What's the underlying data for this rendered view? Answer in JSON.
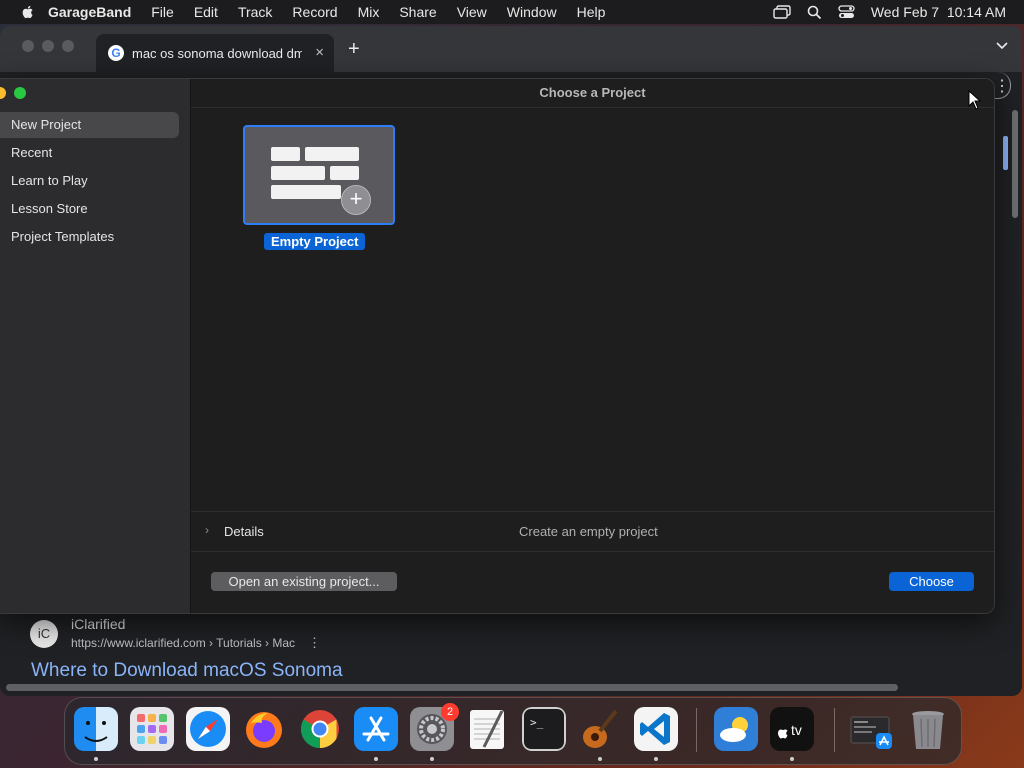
{
  "menubar": {
    "app_name": "GarageBand",
    "menus": [
      "File",
      "Edit",
      "Track",
      "Record",
      "Mix",
      "Share",
      "View",
      "Window",
      "Help"
    ],
    "datetime": "Wed Feb 7  10:14 AM"
  },
  "browser": {
    "tab_title": "mac os sonoma download dmg",
    "tab_close": "×",
    "new_tab": "+",
    "result": {
      "favicon_text": "iC",
      "site_name": "iClarified",
      "url": "https://www.iclarified.com › Tutorials › Mac",
      "more": "⋮",
      "title": "Where to Download macOS Sonoma"
    }
  },
  "dialog": {
    "title": "Choose a Project",
    "sidebar": {
      "items": [
        {
          "label": "New Project",
          "selected": true
        },
        {
          "label": "Recent",
          "selected": false
        },
        {
          "label": "Learn to Play",
          "selected": false
        },
        {
          "label": "Lesson Store",
          "selected": false
        },
        {
          "label": "Project Templates",
          "selected": false
        }
      ]
    },
    "project": {
      "label": "Empty Project",
      "icon": "empty-project-icon"
    },
    "details": {
      "chevron": "›",
      "label": "Details",
      "description": "Create an empty project"
    },
    "buttons": {
      "open_existing": "Open an existing project...",
      "choose": "Choose"
    }
  },
  "dock": {
    "apps": [
      "Finder",
      "Launchpad",
      "Safari",
      "Firefox",
      "Google Chrome",
      "App Store",
      "System Settings",
      "TextEdit",
      "Terminal",
      "GarageBand",
      "Visual Studio Code",
      "Weather",
      "Apple TV",
      "Downloads",
      "Trash"
    ],
    "settings_badge": "2",
    "tv_label": "tv"
  },
  "colors": {
    "accent": "#0a64d6",
    "selection_border": "#2e7cf6",
    "close_light": "#ff5f57",
    "minimize_light": "#febc2e",
    "zoom_light": "#28c840",
    "link": "#8ab4f8"
  }
}
